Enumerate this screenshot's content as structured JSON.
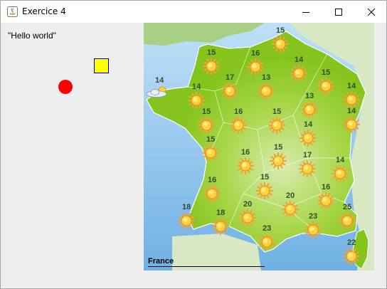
{
  "window": {
    "title": "Exercice 4"
  },
  "canvas": {
    "text": "\"Hello world\""
  },
  "map": {
    "region": "France",
    "colors": {
      "sea": "#8ec5ee",
      "land": "#84c41c",
      "land_light": "#b7de5a"
    },
    "temperatures": [
      "15",
      "15",
      "16",
      "14",
      "14",
      "17",
      "13",
      "15",
      "14",
      "14",
      "13",
      "14",
      "15",
      "16",
      "15",
      "14",
      "15",
      "16",
      "16",
      "15",
      "17",
      "14",
      "15",
      "20",
      "16",
      "18",
      "18",
      "20",
      "23",
      "25",
      "23",
      "22"
    ]
  }
}
